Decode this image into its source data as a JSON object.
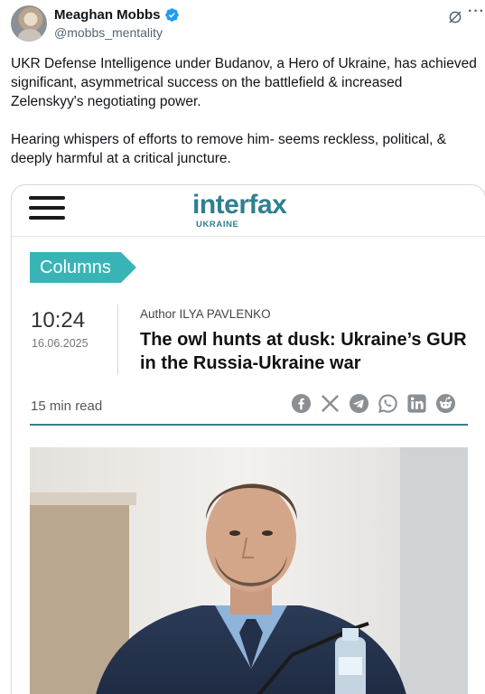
{
  "author": {
    "name": "Meaghan Mobbs",
    "handle": "@mobbs_mentality",
    "verified": true
  },
  "tweet": {
    "paragraphs": [
      "UKR Defense Intelligence under Budanov, a Hero of Ukraine, has achieved significant, asymmetrical success on the battlefield & increased Zelenskyy's negotiating power.",
      "Hearing whispers of efforts to remove him- seems reckless, political, & deeply harmful at a critical juncture."
    ]
  },
  "icons": {
    "more": "more-icon",
    "grok": "grok-icon"
  },
  "card": {
    "logo_main": "interfax",
    "logo_sub": "UKRAINE",
    "section_badge": "Columns",
    "time": "10:24",
    "date": "16.06.2025",
    "author_line": "Author ILYA PAVLENKO",
    "headline": "The owl hunts at dusk: Ukraine’s GUR in the Russia-Ukraine war",
    "read_time": "15 min read",
    "share_icons": [
      "facebook-icon",
      "x-icon",
      "telegram-icon",
      "whatsapp-icon",
      "linkedin-icon",
      "reddit-icon"
    ],
    "colors": {
      "brand": "#2f7f8f",
      "badge": "#39b4b6",
      "share_icon": "#8a8f93"
    }
  }
}
